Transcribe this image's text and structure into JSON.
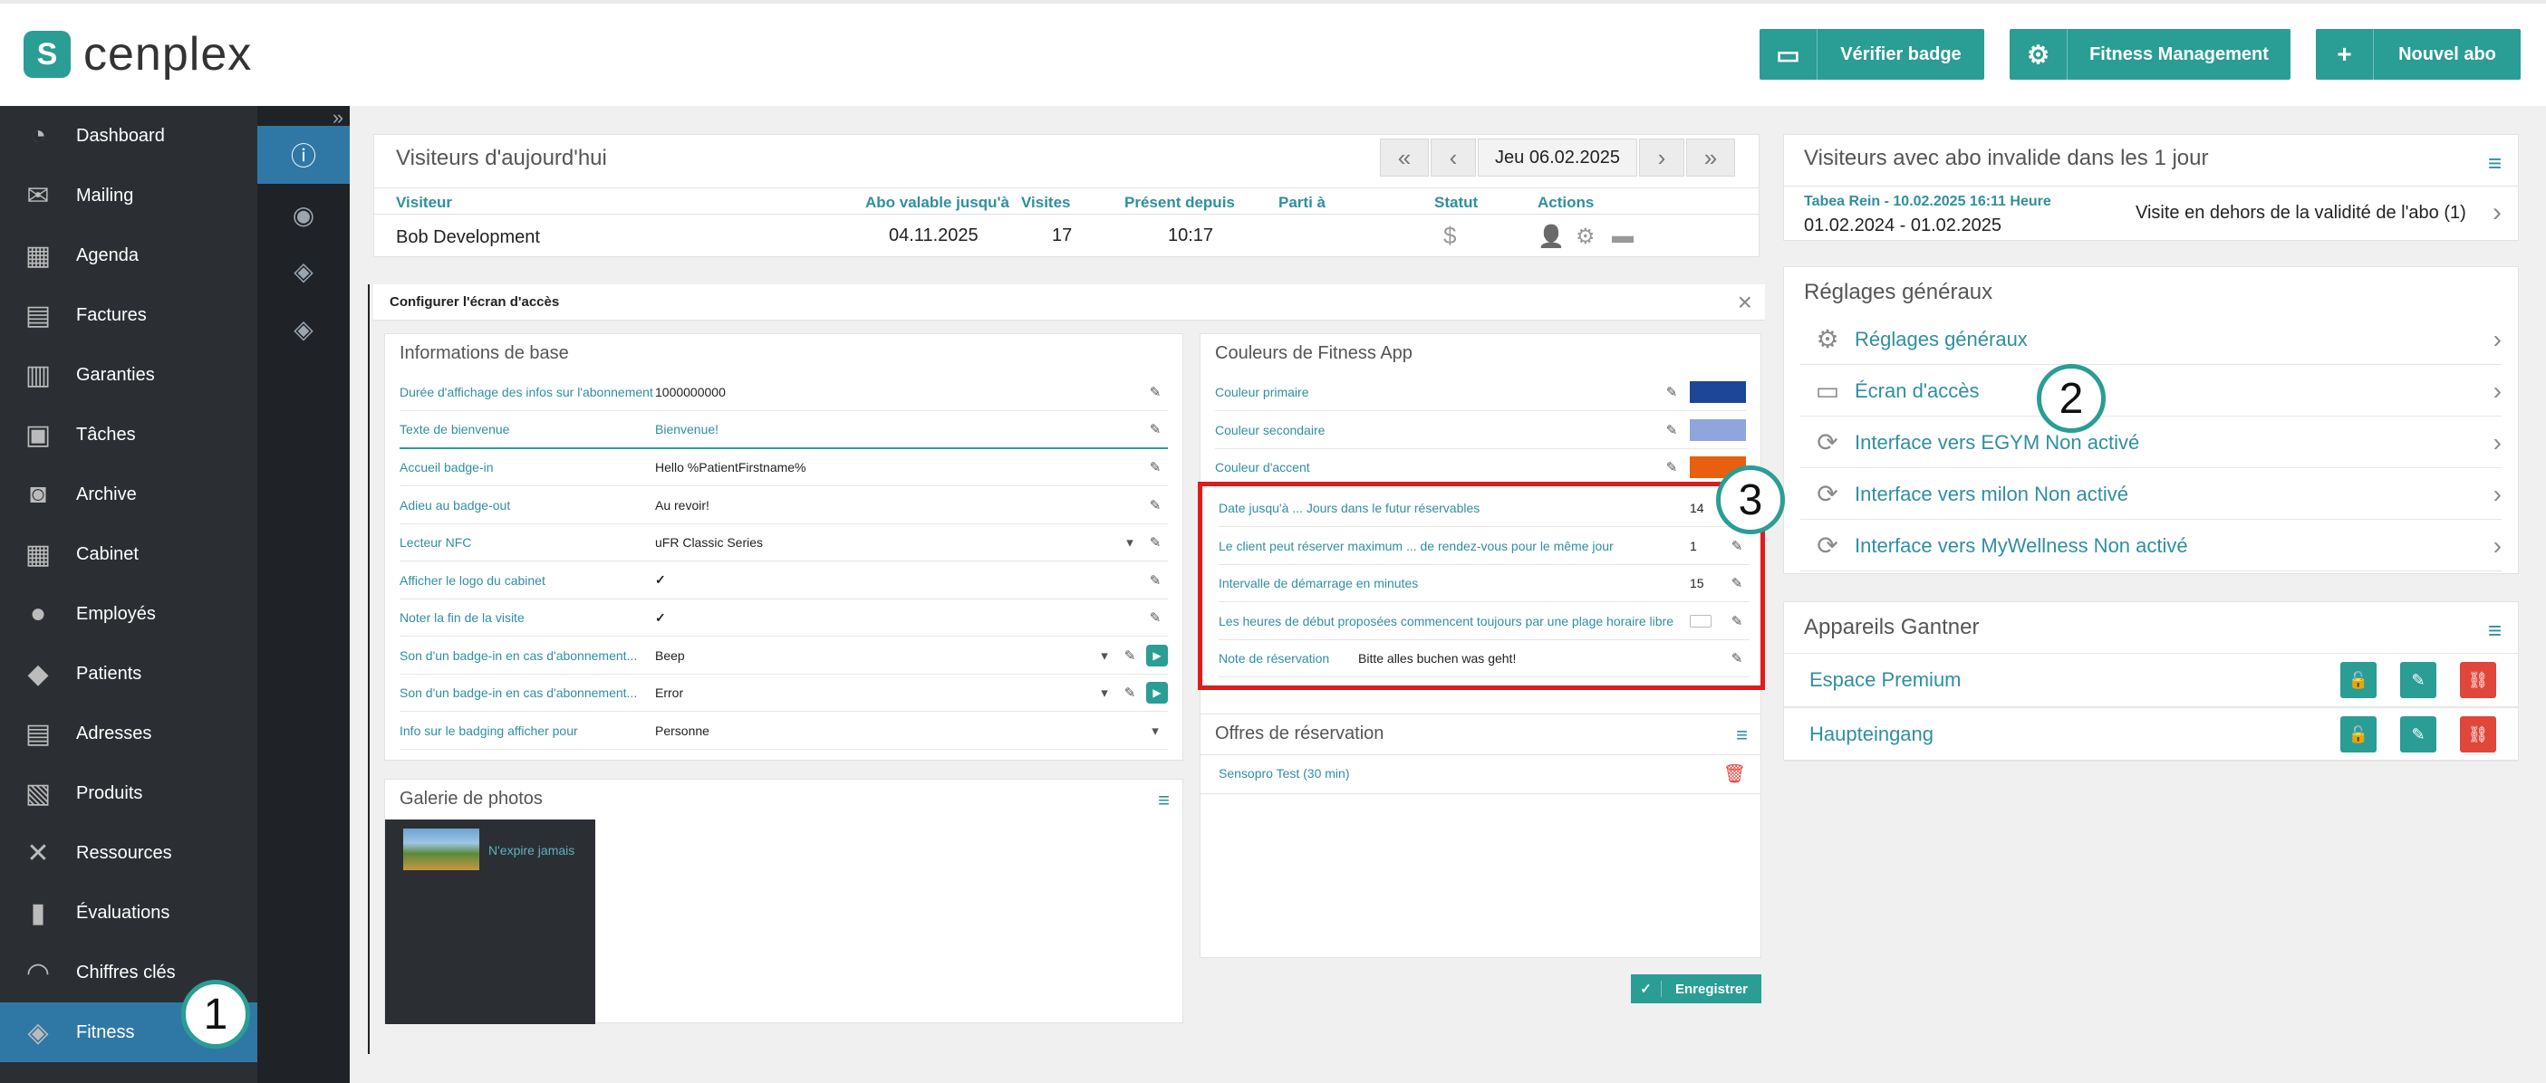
{
  "app": {
    "brand": "cenplex",
    "logo_glyph": "S"
  },
  "topbar": {
    "verify_badge": "Vérifier badge",
    "fitness_mgmt": "Fitness Management",
    "new_subscription": "Nouvel abo",
    "verify_icon": "▭",
    "gear_icon": "⚙",
    "plus_icon": "+"
  },
  "sidebar": {
    "items": [
      {
        "label": "Dashboard",
        "icon": "◔"
      },
      {
        "label": "Mailing",
        "icon": "✉"
      },
      {
        "label": "Agenda",
        "icon": "▦"
      },
      {
        "label": "Factures",
        "icon": "▤"
      },
      {
        "label": "Garanties",
        "icon": "▥"
      },
      {
        "label": "Tâches",
        "icon": "▣"
      },
      {
        "label": "Archive",
        "icon": "◙"
      },
      {
        "label": "Cabinet",
        "icon": "▦"
      },
      {
        "label": "Employés",
        "icon": "●"
      },
      {
        "label": "Patients",
        "icon": "◆"
      },
      {
        "label": "Adresses",
        "icon": "▤"
      },
      {
        "label": "Produits",
        "icon": "▧"
      },
      {
        "label": "Ressources",
        "icon": "✕"
      },
      {
        "label": "Évaluations",
        "icon": "▮"
      },
      {
        "label": "Chiffres clés",
        "icon": "◠"
      },
      {
        "label": "Fitness",
        "icon": "◈"
      }
    ],
    "expand_icon": "»"
  },
  "subnav": {
    "icons": [
      "ⓘ",
      "◉",
      "◈",
      "◈"
    ]
  },
  "visitors": {
    "title": "Visiteurs d'aujourd'hui",
    "date_label": "Jeu 06.02.2025",
    "nav": {
      "first": "«",
      "prev": "‹",
      "next": "›",
      "last": "»"
    },
    "headers": [
      "Visiteur",
      "Abo valable jusqu'à",
      "Visites",
      "Présent depuis",
      "Parti à",
      "Statut",
      "Actions"
    ],
    "rows": [
      {
        "visitor": "Bob Development",
        "valid_until": "04.11.2025",
        "visits": "17",
        "present_since": "10:17",
        "left_at": "",
        "status": "$"
      }
    ],
    "action_icons": [
      "👤",
      "⚙",
      "▬"
    ]
  },
  "config": {
    "title": "Configurer l'écran d'accès",
    "close": "×",
    "basic": {
      "title": "Informations de base",
      "rows": [
        {
          "label": "Durée d'affichage des infos sur l'abonnement",
          "value": "1000000000"
        },
        {
          "label": "Texte de bienvenue",
          "value": "Bienvenue!"
        },
        {
          "label": "Accueil badge-in",
          "value": "Hello %PatientFirstname%"
        },
        {
          "label": "Adieu au badge-out",
          "value": "Au revoir!"
        },
        {
          "label": "Lecteur NFC",
          "value": "uFR Classic Series"
        },
        {
          "label": "Afficher le logo du cabinet",
          "value": "✓"
        },
        {
          "label": "Noter la fin de la visite",
          "value": "✓"
        },
        {
          "label": "Son d'un badge-in en cas d'abonnement...",
          "value": "Beep"
        },
        {
          "label": "Son d'un badge-in en cas d'abonnement...",
          "value": "Error"
        },
        {
          "label": "Info sur le badging afficher pour",
          "value": "Personne"
        }
      ]
    },
    "gallery": {
      "title": "Galerie de photos",
      "photo_caption": "N'expire jamais"
    },
    "colors": {
      "title": "Couleurs de Fitness App",
      "rows": [
        {
          "label": "Couleur primaire",
          "color": "#1d4598"
        },
        {
          "label": "Couleur secondaire",
          "color": "#8ea6dc"
        },
        {
          "label": "Couleur d'accent",
          "color": "#e8600f"
        }
      ]
    },
    "booking": {
      "rows": [
        {
          "label": "Date jusqu'à ... Jours dans le futur réservables",
          "value": "14"
        },
        {
          "label": "Le client peut réserver maximum ... de rendez-vous pour le même jour",
          "value": "1"
        },
        {
          "label": "Intervalle de démarrage en minutes",
          "value": "15"
        },
        {
          "label": "Les heures de début proposées commencent toujours par une plage horaire libre",
          "value": ""
        },
        {
          "label": "Note de réservation",
          "value": "Bitte alles buchen was geht!"
        }
      ]
    },
    "offers": {
      "title": "Offres de réservation",
      "items": [
        "Sensopro Test (30 min)"
      ]
    },
    "save": "Enregistrer"
  },
  "invalid": {
    "title": "Visiteurs avec abo invalide dans les 1 jour",
    "entry_link": "Tabea Rein - 10.02.2025 16:11 Heure",
    "entry_period": "01.02.2024 - 01.02.2025",
    "entry_reason": "Visite en dehors de la validité de l'abo (1)"
  },
  "general": {
    "title": "Réglages généraux",
    "links": [
      {
        "label": "Réglages généraux",
        "icon": "⚙"
      },
      {
        "label": "Écran d'accès",
        "icon": "▭"
      },
      {
        "label": "Interface vers EGYM Non activé",
        "icon": "⟳"
      },
      {
        "label": "Interface vers milon Non activé",
        "icon": "⟳"
      },
      {
        "label": "Interface vers MyWellness Non activé",
        "icon": "⟳"
      }
    ]
  },
  "gantner": {
    "title": "Appareils Gantner",
    "devices": [
      "Espace Premium",
      "Haupteingang"
    ]
  },
  "callouts": [
    "1",
    "2",
    "3"
  ],
  "colors": {
    "accent": "#2a9d95",
    "highlight": "#e01b1b",
    "sidebar": "#2b2f33",
    "active": "#2f78a6"
  }
}
